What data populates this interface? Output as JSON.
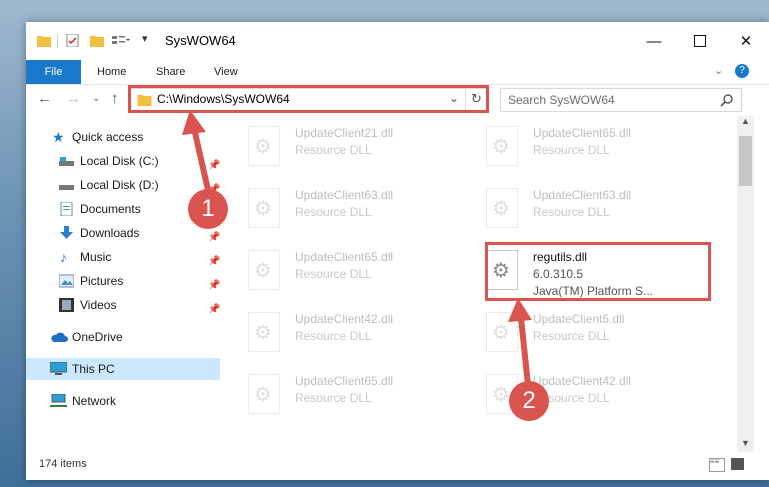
{
  "window": {
    "title": "SysWOW64"
  },
  "ribbon": {
    "tabs": [
      "File",
      "Home",
      "Share",
      "View"
    ]
  },
  "address": {
    "path": "C:\\Windows\\SysWOW64"
  },
  "search": {
    "placeholder": "Search SysWOW64"
  },
  "nav": {
    "items": [
      {
        "label": "Quick access",
        "icon": "star-icon"
      },
      {
        "label": "Local Disk (C:)",
        "icon": "drive-icon"
      },
      {
        "label": "Local Disk (D:)",
        "icon": "drive-icon"
      },
      {
        "label": "Documents",
        "icon": "documents-icon"
      },
      {
        "label": "Downloads",
        "icon": "download-icon"
      },
      {
        "label": "Music",
        "icon": "music-icon"
      },
      {
        "label": "Pictures",
        "icon": "pictures-icon"
      },
      {
        "label": "Videos",
        "icon": "videos-icon"
      },
      {
        "label": "OneDrive",
        "icon": "cloud-icon"
      },
      {
        "label": "This PC",
        "icon": "computer-icon"
      },
      {
        "label": "Network",
        "icon": "network-icon"
      }
    ]
  },
  "files": [
    {
      "name": "UpdateClient21.dll",
      "desc": "Resource DLL"
    },
    {
      "name": "UpdateClient65.dll",
      "desc": "Resource DLL"
    },
    {
      "name": "UpdateClient63.dll",
      "desc": "Resource DLL"
    },
    {
      "name": "UpdateClient63.dll",
      "desc": "Resource DLL"
    },
    {
      "name": "UpdateClient65.dll",
      "desc": "Resource DLL"
    },
    {
      "name": "regutils.dll",
      "desc": "6.0.310.5",
      "desc2": "Java(TM) Platform S..."
    },
    {
      "name": "UpdateClient42.dll",
      "desc": "Resource DLL"
    },
    {
      "name": "UpdateClient5.dll",
      "desc": "Resource DLL"
    },
    {
      "name": "UpdateClient65.dll",
      "desc": "Resource DLL"
    },
    {
      "name": "UpdateClient42.dll",
      "desc": "Resource DLL"
    }
  ],
  "status": {
    "count": "174 items"
  },
  "annotations": {
    "step1": "1",
    "step2": "2"
  },
  "colors": {
    "accent": "#1979ca",
    "highlight": "#d9534f",
    "selected": "#cce8ff"
  }
}
